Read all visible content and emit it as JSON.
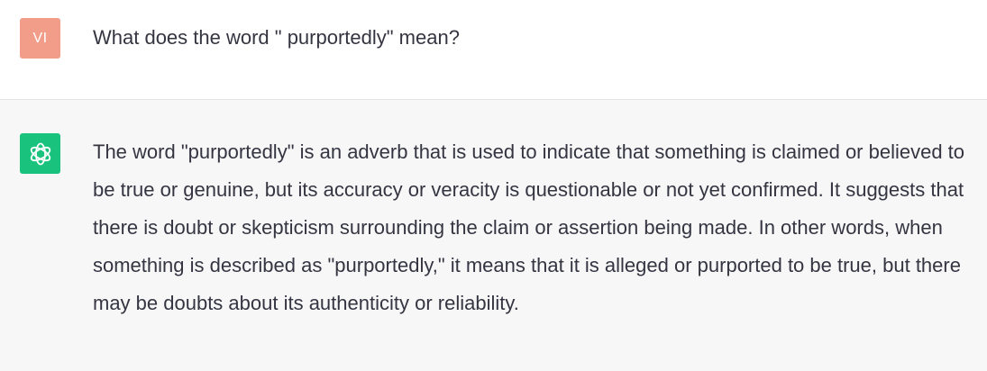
{
  "conversation": {
    "user": {
      "avatar_initials": "VI",
      "avatar_color": "#f19d8a",
      "message": "What does the word \" purportedly\" mean?"
    },
    "assistant": {
      "avatar_icon": "openai-logo-icon",
      "avatar_color": "#19c37d",
      "message": "The word \"purportedly\" is an adverb that is used to indicate that something is claimed or believed to be true or genuine, but its accuracy or veracity is questionable or not yet confirmed. It suggests that there is doubt or skepticism surrounding the claim or assertion being made. In other words, when something is described as \"purportedly,\" it means that it is alleged or purported to be true, but there may be doubts about its authenticity or reliability."
    }
  }
}
